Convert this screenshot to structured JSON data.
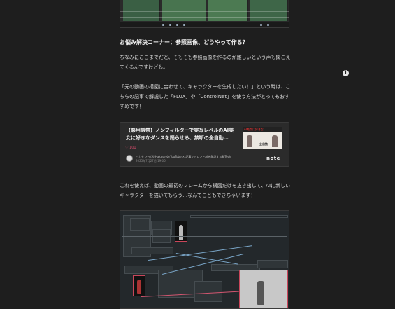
{
  "article": {
    "heading": "お悩み解決コーナー：参照画像、どうやって作る？",
    "para1": "ちなみにここまでだと、そもそも参照画像を作るのが難しいという声も聞こえてくるんですけども。",
    "para2": "「元の動画の構図に合わせて、キャラクターを生成したい！」という時は、こちらの記事で解説した「FLUX」や「ControlNet」を使う方法がとってもおすすめです！",
    "para3": "これを使えば、動画の最初のフレームから構図だけを抜き出して、AIに新しいキャラクターを描いてもらう…なんてこともできちゃいます！"
  },
  "card": {
    "title": "【悪用厳禁】ノンフィルターで実写レベルのAI美女に好きなダンスを踊らせる、禁断の全自動…",
    "likes": "♡ 101",
    "author": "ハカセ アイ(Ai-Hakase)🐿YouTube × 記事でトレンドAIを解説する動Tech",
    "date": "2025年7月27日 19:06",
    "thumb_banner": "AI美女に好きな",
    "thumb_caption": "全自動",
    "logo": "note"
  },
  "icons": {
    "info": "info-icon"
  }
}
